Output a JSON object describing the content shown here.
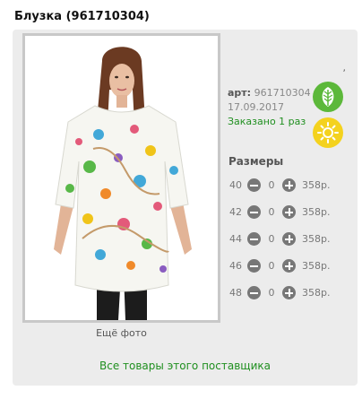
{
  "product": {
    "title": "Блузка (961710304)",
    "stray_mark": ",",
    "article_label": "арт:",
    "article_number": "961710304",
    "date": "17.09.2017",
    "ordered": "Заказано 1 раз",
    "more_photos": "Ещё фото",
    "supplier_link": "Все товары этого поставщика"
  },
  "icons": {
    "eco": {
      "name": "leaf-icon",
      "color": "#5cb83a"
    },
    "season": {
      "name": "sun-icon",
      "color": "#f4d21e"
    },
    "decrement": "minus-circle-icon",
    "increment": "plus-circle-icon"
  },
  "sizes": {
    "title": "Размеры",
    "rows": [
      {
        "size": "40",
        "quantity": "0",
        "price": "358р."
      },
      {
        "size": "42",
        "quantity": "0",
        "price": "358р."
      },
      {
        "size": "44",
        "quantity": "0",
        "price": "358р."
      },
      {
        "size": "46",
        "quantity": "0",
        "price": "358р."
      },
      {
        "size": "48",
        "quantity": "0",
        "price": "358р."
      }
    ]
  },
  "colors": {
    "link_green": "#1f8f1f",
    "panel_bg": "#ececec"
  }
}
